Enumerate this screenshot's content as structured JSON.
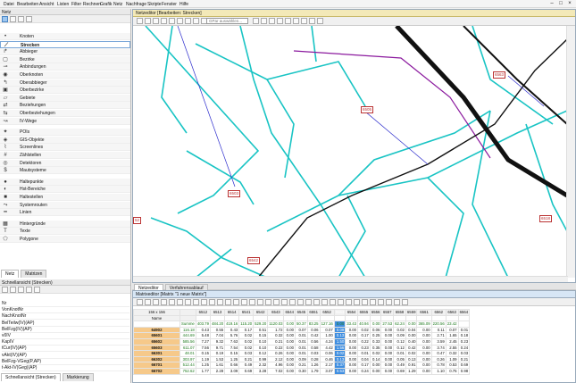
{
  "menu": [
    "Datei",
    "Bearbeiten",
    "Ansicht",
    "Listen",
    "Filter",
    "Rechnen",
    "Grafik",
    "Netz",
    "Nachfrage",
    "Skripte",
    "Fenster",
    "Hilfe"
  ],
  "window_controls": [
    "–",
    "□",
    "×"
  ],
  "left_panel": {
    "title": "Netz",
    "items": [
      {
        "label": "Knoten",
        "icon": "node-icon"
      },
      {
        "label": "Strecken",
        "icon": "link-icon",
        "selected": true
      },
      {
        "label": "Abbieger",
        "icon": "turn-icon"
      },
      {
        "label": "Bezirke",
        "icon": "zone-icon"
      },
      {
        "label": "Anbindungen",
        "icon": "connector-icon"
      },
      {
        "label": "Oberknoten",
        "icon": "main-node-icon"
      },
      {
        "label": "Oberabbieger",
        "icon": "main-turn-icon"
      },
      {
        "label": "Oberbezirke",
        "icon": "main-zone-icon"
      },
      {
        "label": "Gebiete",
        "icon": "territory-icon"
      },
      {
        "label": "Beziehungen",
        "icon": "relation-icon"
      },
      {
        "label": "Oberbeziehungen",
        "icon": "main-relation-icon"
      },
      {
        "label": "IV-Wege",
        "icon": "path-icon"
      },
      {
        "label": "POIs",
        "icon": "poi-icon"
      },
      {
        "label": "GIS-Objekte",
        "icon": "gis-icon"
      },
      {
        "label": "Screenlines",
        "icon": "screenline-icon"
      },
      {
        "label": "Zählstellen",
        "icon": "count-icon"
      },
      {
        "label": "Detektoren",
        "icon": "detector-icon"
      },
      {
        "label": "Mautsysteme",
        "icon": "toll-icon"
      },
      {
        "label": "Haltepunkte",
        "icon": "stop-point-icon"
      },
      {
        "label": "Hst-Bereiche",
        "icon": "stop-area-icon"
      },
      {
        "label": "Haltestellen",
        "icon": "stop-icon"
      },
      {
        "label": "Systemrouten",
        "icon": "system-route-icon"
      },
      {
        "label": "Linien",
        "icon": "line-icon"
      },
      {
        "label": "Hintergründe",
        "icon": "background-icon"
      },
      {
        "label": "Texte",
        "icon": "text-icon"
      },
      {
        "label": "Polygone",
        "icon": "polygon-icon"
      }
    ],
    "tabs": [
      "Netz",
      "Matrizen"
    ]
  },
  "quick_view": {
    "title": "Schnellansicht (Strecken)",
    "rows": [
      "Nr",
      "VonKnotNr",
      "NachKnotNr",
      "BelTeilw(IV)(AP)",
      "BelFzg(IV)(AP)",
      "v0IV",
      "KapIV",
      "tCur(IV)(AP)",
      "vAkt(IV)(AP)",
      "BelFzg-VGeg(P,AP)",
      "t-Akt-IV(Geg)(AP)"
    ],
    "tabs": [
      "Schnellansicht (Strecken)",
      "Markierung"
    ]
  },
  "net_editor": {
    "title": "Netzeditor [Bearbeiten: Strecken]",
    "gps_placeholder": "GPar auswählen...",
    "node_labels": [
      "6503",
      "6563",
      "6505",
      "6518",
      "6542",
      "6566",
      "52"
    ]
  },
  "mid_tabs": [
    "Netzeditor",
    "Verfahrensablauf"
  ],
  "matrix": {
    "title": "Matrixeditor [Matrix \"1 neue Matrix\"]",
    "size_label": "156 x 156",
    "name_header": "Name",
    "sum_label": "Summe",
    "columns": [
      "6512",
      "6513",
      "6514",
      "6541",
      "6542",
      "6543",
      "6544",
      "6545",
      "6551",
      "6552",
      "6553",
      "6554",
      "6555",
      "6556",
      "6557",
      "6558",
      "6559",
      "6561",
      "6562",
      "6563",
      "6564"
    ],
    "col_sums": [
      "403.79",
      "484.20",
      "419.16",
      "115.20",
      "529.20",
      "1120.03",
      "0.00",
      "50.37",
      "83.25",
      "127.16",
      "0.00",
      "33.43",
      "40.94",
      "0.00",
      "27.53",
      "62.24",
      "0.00",
      "365.09",
      "220.56",
      "23.42",
      ""
    ],
    "rows": [
      {
        "id": "64902",
        "sum": "116.18",
        "v": [
          "0.43",
          "0.55",
          "0.43",
          "0.17",
          "0.51",
          "1.72",
          "0.00",
          "0.07",
          "0.06",
          "0.07",
          "0.09",
          "0.00",
          "0.02",
          "0.06",
          "0.00",
          "0.02",
          "0.04",
          "0.00",
          "0.11",
          "0.07",
          "0.01"
        ]
      },
      {
        "id": "65601",
        "sum": "444.69",
        "v": [
          "5.48",
          "7.04",
          "5.76",
          "0.02",
          "0.15",
          "0.32",
          "0.00",
          "0.01",
          "0.42",
          "1.00",
          "0.13",
          "0.00",
          "0.17",
          "0.25",
          "0.00",
          "0.09",
          "0.00",
          "0.00",
          "2.71",
          "1.65",
          "0.18"
        ]
      },
      {
        "id": "65602",
        "sum": "585.56",
        "v": [
          "7.27",
          "9.32",
          "7.63",
          "0.02",
          "0.10",
          "0.21",
          "0.00",
          "0.01",
          "0.56",
          "4.24",
          "1.50",
          "0.00",
          "0.22",
          "0.33",
          "0.00",
          "0.12",
          "0.40",
          "0.00",
          "3.59",
          "2.45",
          "0.23"
        ]
      },
      {
        "id": "65603",
        "sum": "611.07",
        "v": [
          "7.56",
          "9.71",
          "7.54",
          "0.02",
          "0.10",
          "0.22",
          "0.00",
          "0.01",
          "0.58",
          "4.42",
          "1.56",
          "0.00",
          "0.23",
          "0.35",
          "0.00",
          "0.12",
          "0.42",
          "0.00",
          "3.74",
          "2.55",
          "0.24"
        ]
      },
      {
        "id": "66301",
        "sum": "48.01",
        "v": [
          "0.15",
          "0.19",
          "0.15",
          "0.03",
          "0.12",
          "0.26",
          "0.00",
          "0.01",
          "0.03",
          "0.06",
          "0.02",
          "0.00",
          "0.01",
          "0.02",
          "0.00",
          "0.01",
          "0.02",
          "0.00",
          "0.47",
          "0.32",
          "0.03"
        ]
      },
      {
        "id": "66302",
        "sum": "303.97",
        "v": [
          "1.19",
          "1.53",
          "1.25",
          "0.21",
          "0.99",
          "2.12",
          "0.00",
          "0.09",
          "0.28",
          "0.46",
          "0.13",
          "0.00",
          "0.04",
          "0.14",
          "0.00",
          "0.05",
          "0.13",
          "0.00",
          "0.26",
          "1.09",
          "0.21"
        ]
      },
      {
        "id": "66701",
        "sum": "512.44",
        "v": [
          "1.25",
          "1.61",
          "0.66",
          "0.49",
          "2.32",
          "4.96",
          "0.00",
          "0.21",
          "1.26",
          "2.17",
          "0.37",
          "0.00",
          "0.17",
          "0.00",
          "0.00",
          "0.49",
          "0.91",
          "0.00",
          "0.78",
          "0.53",
          "0.69"
        ]
      },
      {
        "id": "66702",
        "sum": "752.62",
        "v": [
          "1.77",
          "2.28",
          "3.09",
          "0.69",
          "3.28",
          "7.02",
          "0.00",
          "0.30",
          "1.79",
          "3.07",
          "0.53",
          "0.00",
          "0.24",
          "0.00",
          "0.00",
          "0.69",
          "1.29",
          "0.00",
          "1.10",
          "0.75",
          "0.98"
        ]
      }
    ]
  },
  "colors": {
    "cyan_link": "#19c4c4",
    "black_link": "#111111",
    "purple_link": "#8b1a9e",
    "selected_col": "#3f8ee0",
    "zone_id": "#f6c98a",
    "editor_header": "#f3e9b8"
  }
}
